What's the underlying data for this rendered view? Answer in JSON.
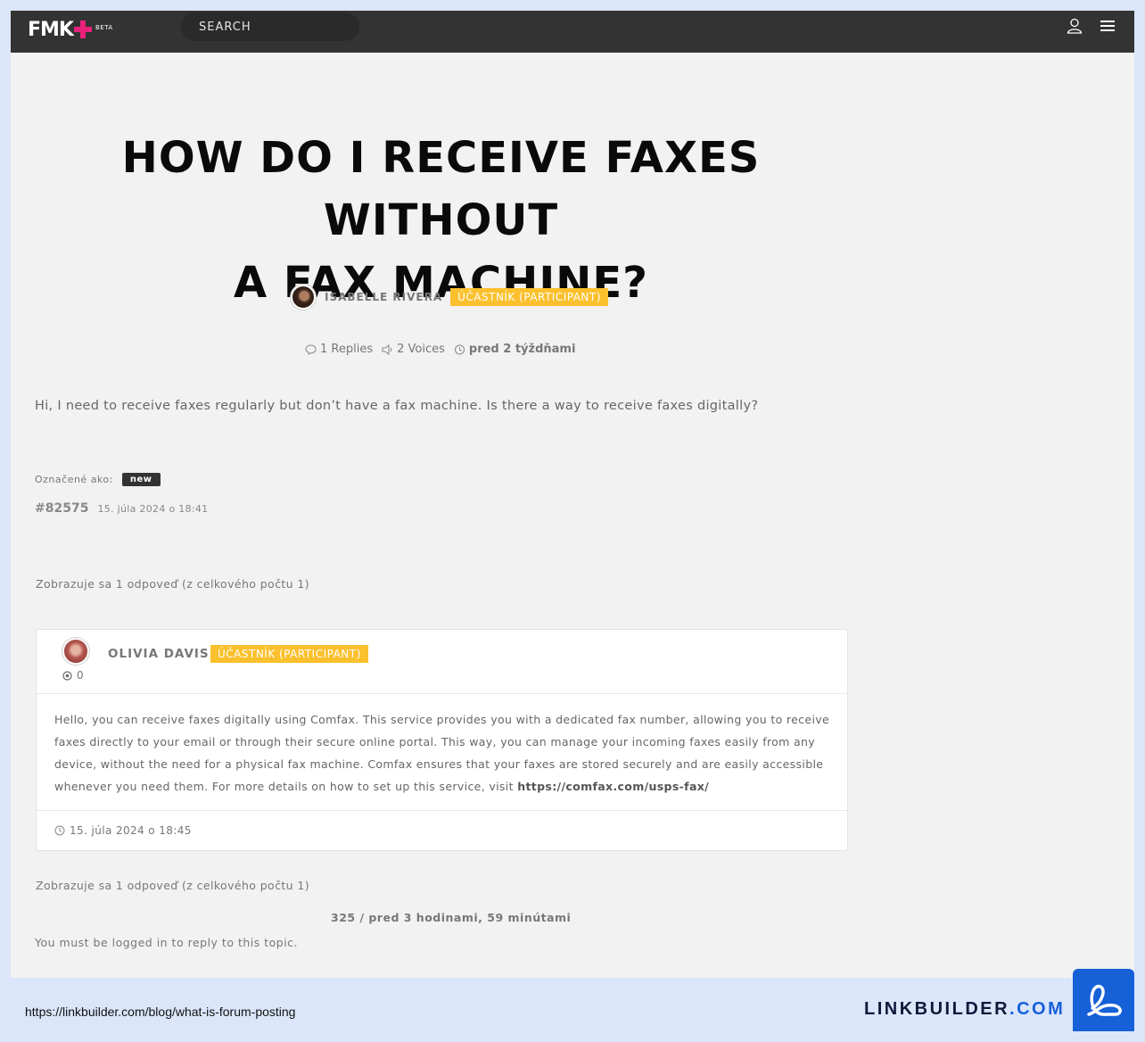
{
  "nav": {
    "logo": "FMK",
    "logo_badge": "BETA",
    "search_label": "SEARCH"
  },
  "topic": {
    "title_line1": "HOW DO I RECEIVE FAXES WITHOUT",
    "title_line2": "A FAX MACHINE?",
    "author": "ISABELLE RIVERA",
    "author_role": "ÚČASTNÍK (PARTICIPANT)",
    "replies": "1 Replies",
    "voices": "2 Voices",
    "freshness": "pred 2 týždňami",
    "body": "Hi, I need to receive faxes regularly but don’t have a fax machine. Is there a way to receive faxes digitally?",
    "tagged_label": "Označené ako:",
    "tag": "new",
    "post_id": "#82575",
    "post_date": "15. júla 2024 o 18:41"
  },
  "pagination": {
    "showing": "Zobrazuje sa 1 odpoveď (z celkového počtu 1)"
  },
  "reply": {
    "author": "OLIVIA DAVIS",
    "author_role": "ÚČASTNÍK (PARTICIPANT)",
    "points": "0",
    "body_text": "Hello, you can receive faxes digitally using Comfax. This service provides you with a dedicated fax number, allowing you to receive faxes directly to your email or through their secure online portal. This way, you can manage your incoming faxes easily from any device, without the need for a physical fax machine. Comfax ensures that your faxes are stored securely and are easily accessible whenever you need them. For more details on how to set up this service, visit",
    "link": "https://comfax.com/usps-fax/",
    "date": "15. júla 2024 o 18:45"
  },
  "footer": {
    "last_active": "325 / pred 3 hodinami, 59 minútami",
    "login_notice": "You must be logged in to reply to this topic."
  },
  "caption": {
    "source_url": "https://linkbuilder.com/blog/what-is-forum-posting",
    "brand_name": "LINKBUILDER",
    "brand_tld": ".COM"
  },
  "colors": {
    "topbar": "#333333",
    "badge": "#fbc02d",
    "logo_plus": "#e8217a",
    "brand_blue": "#1660d8",
    "outer_background": "#dbe6fb"
  }
}
